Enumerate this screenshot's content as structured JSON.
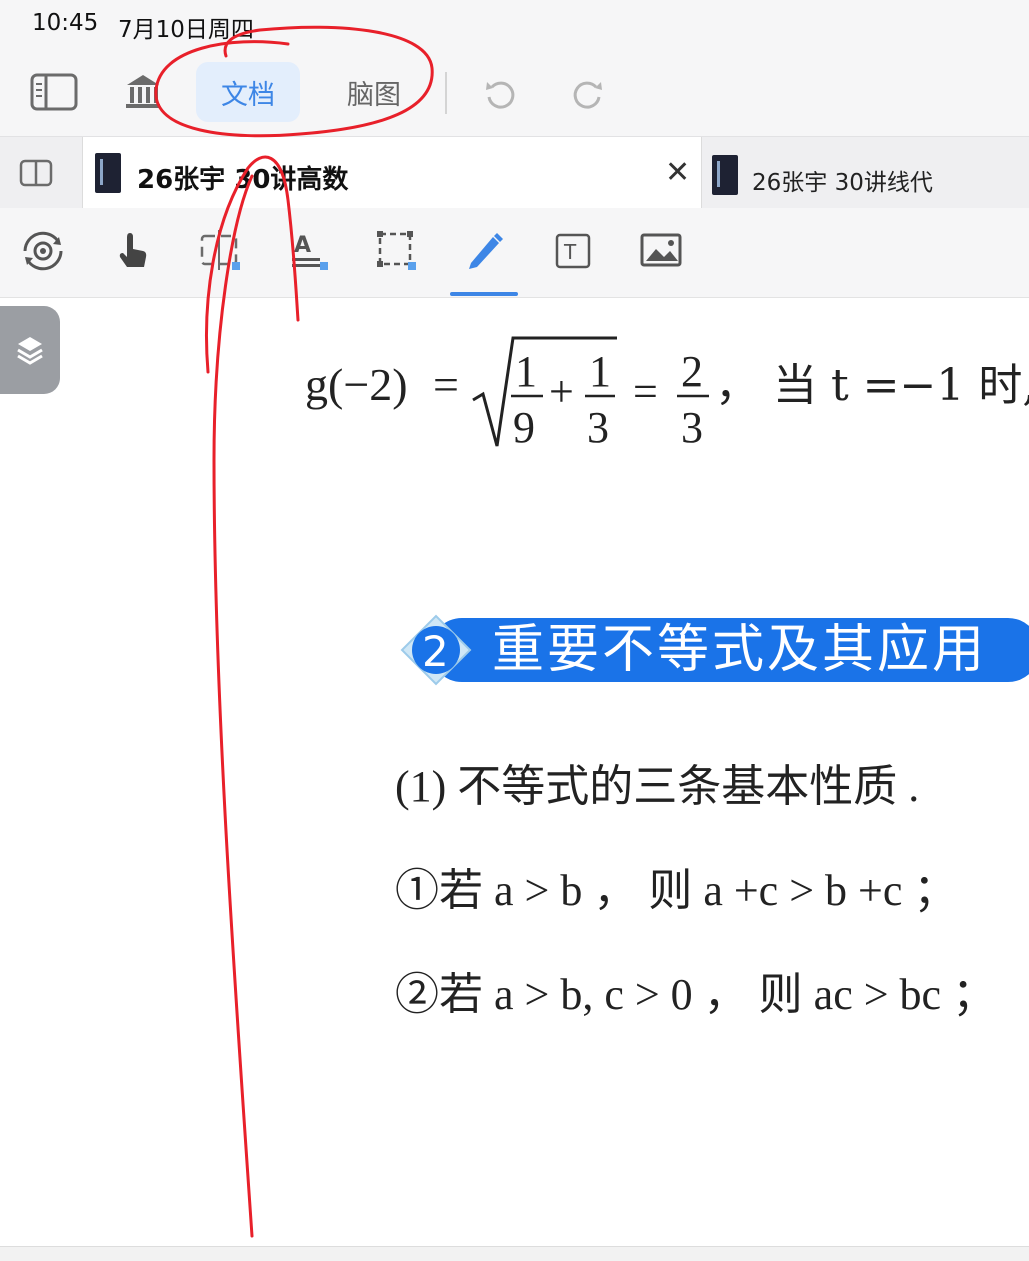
{
  "status_bar": {
    "time": "10:45",
    "date": "7月10日周四"
  },
  "toolbar": {
    "segments": [
      {
        "label": "文档",
        "active": true
      },
      {
        "label": "脑图",
        "active": false
      }
    ],
    "accent_color": "#3d86e6"
  },
  "tabs": [
    {
      "title": "26张宇 30讲高数",
      "active": true,
      "close_symbol": "✕"
    },
    {
      "title": "26张宇 30讲线代",
      "active": false
    }
  ],
  "tools": [
    "lasso-gear-icon",
    "hand-icon",
    "select-resize-icon",
    "text-highlight-icon",
    "rect-select-icon",
    "pen-icon",
    "textbox-icon",
    "image-icon"
  ],
  "document": {
    "formula": {
      "lhs": "g(−2)",
      "eq": "=",
      "frac1_num": "1",
      "frac1_den": "9",
      "plus": "+",
      "frac2_num": "1",
      "frac2_den": "3",
      "eq2": "=",
      "frac3_num": "2",
      "frac3_den": "3",
      "tail": "， 当 t =−1 时,"
    },
    "section": {
      "number": "2",
      "title": "重要不等式及其应用",
      "color": "#1a73e8"
    },
    "lines": [
      "(1) 不等式的三条基本性质 .",
      "①若 a > b ， 则 a +c > b +c ；",
      "②若 a > b, c > 0 ， 则 ac > bc ；"
    ]
  },
  "annotation_color": "#e8202a"
}
